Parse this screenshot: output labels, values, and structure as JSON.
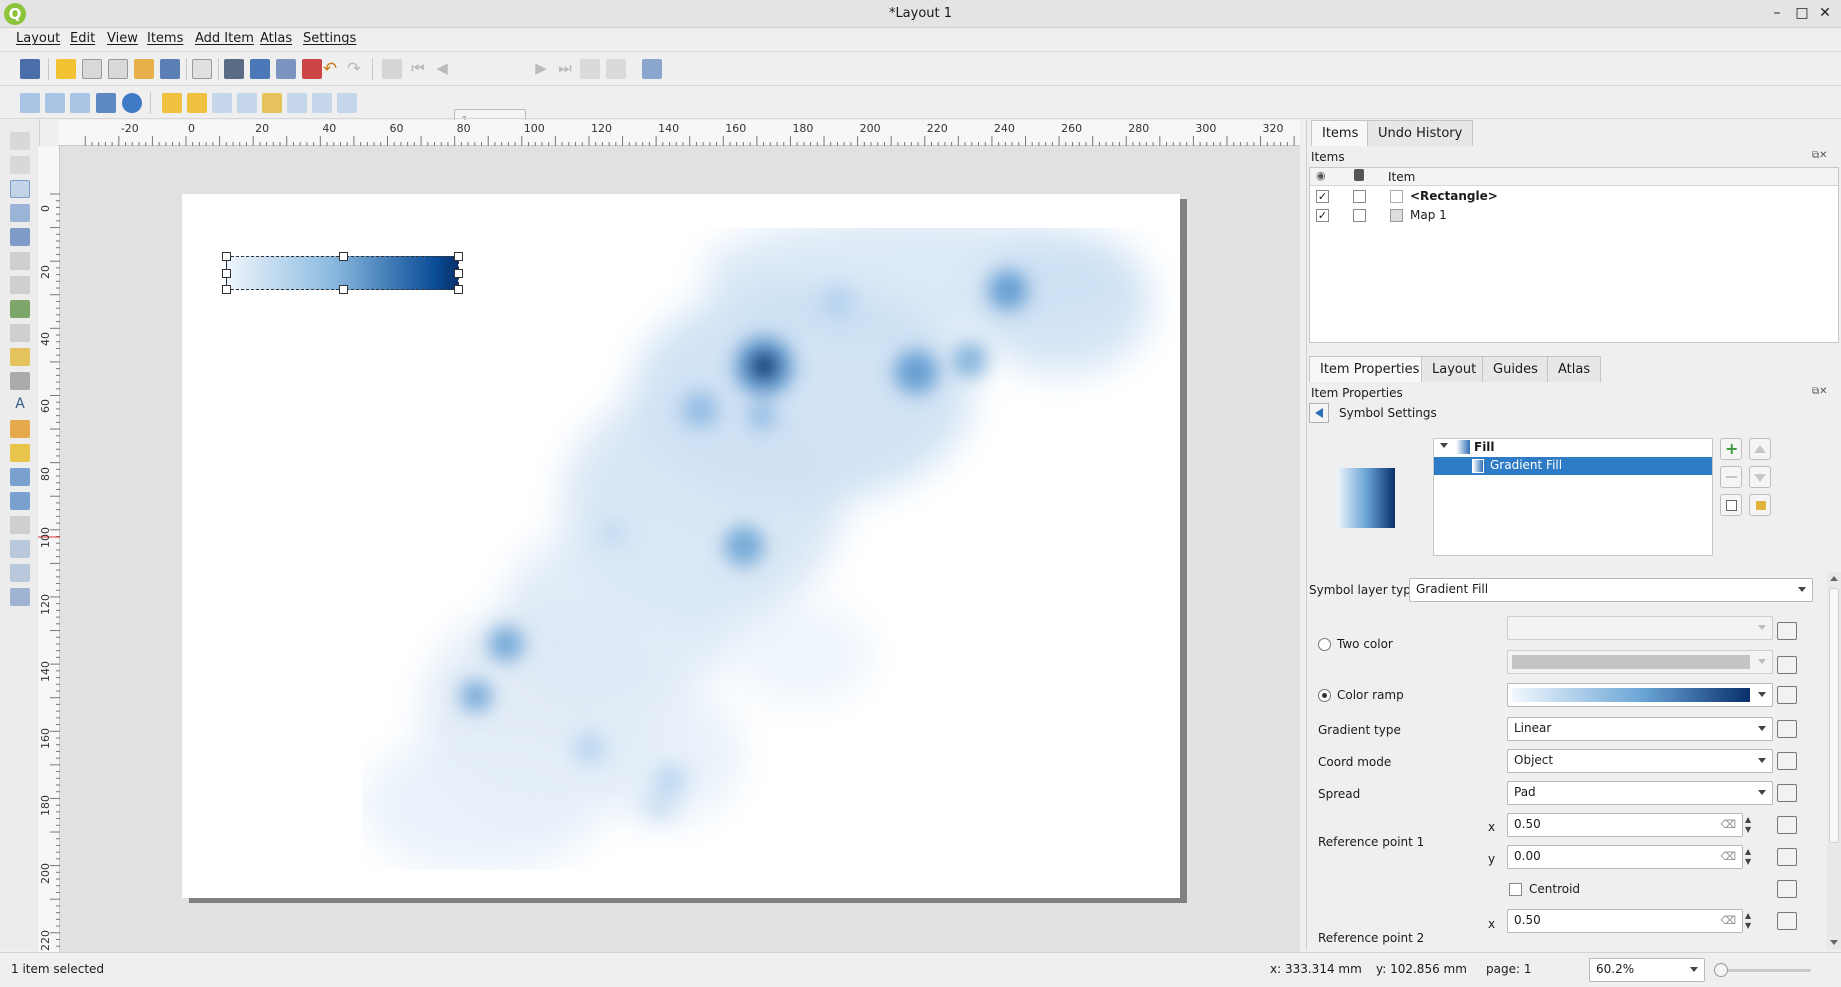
{
  "window": {
    "title": "*Layout 1",
    "logo": "Q",
    "minimize": "–",
    "maximize": "□",
    "close": "✕"
  },
  "menu": [
    "Layout",
    "Edit",
    "View",
    "Items",
    "Add Item",
    "Atlas",
    "Settings"
  ],
  "toolbar": {
    "page_number": "1"
  },
  "ruler": {
    "h_labels": [
      "-20",
      "0",
      "20",
      "40",
      "60",
      "80",
      "100",
      "120",
      "140",
      "160",
      "180",
      "200",
      "220",
      "240",
      "260",
      "280",
      "300",
      "320"
    ],
    "v_labels": [
      "0",
      "20",
      "40",
      "60",
      "80",
      "100",
      "120",
      "140",
      "160",
      "180",
      "200",
      "220"
    ]
  },
  "items_panel": {
    "tabs": [
      "Items",
      "Undo History"
    ],
    "title": "Items",
    "column": "Item",
    "rows": [
      {
        "label": "<Rectangle>",
        "visible": "✓",
        "bold": true
      },
      {
        "label": "Map 1",
        "visible": "✓",
        "bold": false
      }
    ]
  },
  "props_panel": {
    "tabs": [
      "Item Properties",
      "Layout",
      "Guides",
      "Atlas"
    ],
    "title": "Item Properties",
    "subtitle": "Symbol Settings",
    "tree": {
      "fill": "Fill",
      "gradient_fill": "Gradient Fill"
    },
    "symbol_layer_type_label": "Symbol layer type",
    "symbol_layer_type": "Gradient Fill",
    "two_color": "Two color",
    "color_ramp": "Color ramp",
    "gradient_type_label": "Gradient type",
    "gradient_type": "Linear",
    "coord_mode_label": "Coord mode",
    "coord_mode": "Object",
    "spread_label": "Spread",
    "spread": "Pad",
    "ref_point_1": "Reference point 1",
    "ref_point_2": "Reference point 2",
    "rp1_x": "0.50",
    "rp1_y": "0.00",
    "rp2_x": "0.50",
    "x_label": "x",
    "y_label": "y",
    "centroid": "Centroid"
  },
  "status": {
    "selection": "1 item selected",
    "x": "x: 333.314 mm",
    "y": "y: 102.856 mm",
    "page": "page: 1",
    "zoom": "60.2%"
  },
  "colors": {
    "accent": "#2f7cc6",
    "ramp_start": "#f1f7fd",
    "ramp_end": "#08306b"
  }
}
